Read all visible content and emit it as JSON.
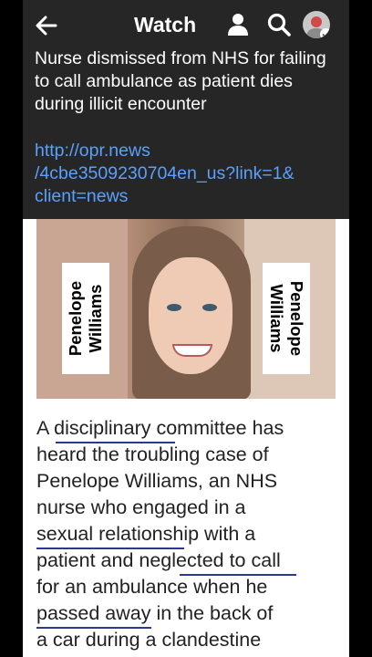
{
  "header": {
    "title": "Watch",
    "icons": [
      "back-arrow-icon",
      "person-icon",
      "search-icon",
      "avatar"
    ]
  },
  "post": {
    "headline": "Nurse dismissed from NHS for failing to call ambulance as patient dies during illicit encounter",
    "link_lines": [
      "http://opr.news",
      "/4cbe3509230704en_us?link=1&",
      "client=news"
    ]
  },
  "image": {
    "name_label_left": "Penelope\nWilliams",
    "name_label_right": "Penelope\nWilliams"
  },
  "article": {
    "lines": [
      "A disciplinary committee has",
      "heard the troubling case of",
      "Penelope Williams, an NHS",
      "nurse who engaged in a",
      "sexual relationship with a",
      "patient and neglected to call",
      "for an ambulance when he",
      "passed away in the back of",
      "a car during a clandestine"
    ]
  },
  "colors": {
    "link": "#5aa0ff",
    "header_bg": "#262626",
    "underline": "#2a3a8f"
  }
}
